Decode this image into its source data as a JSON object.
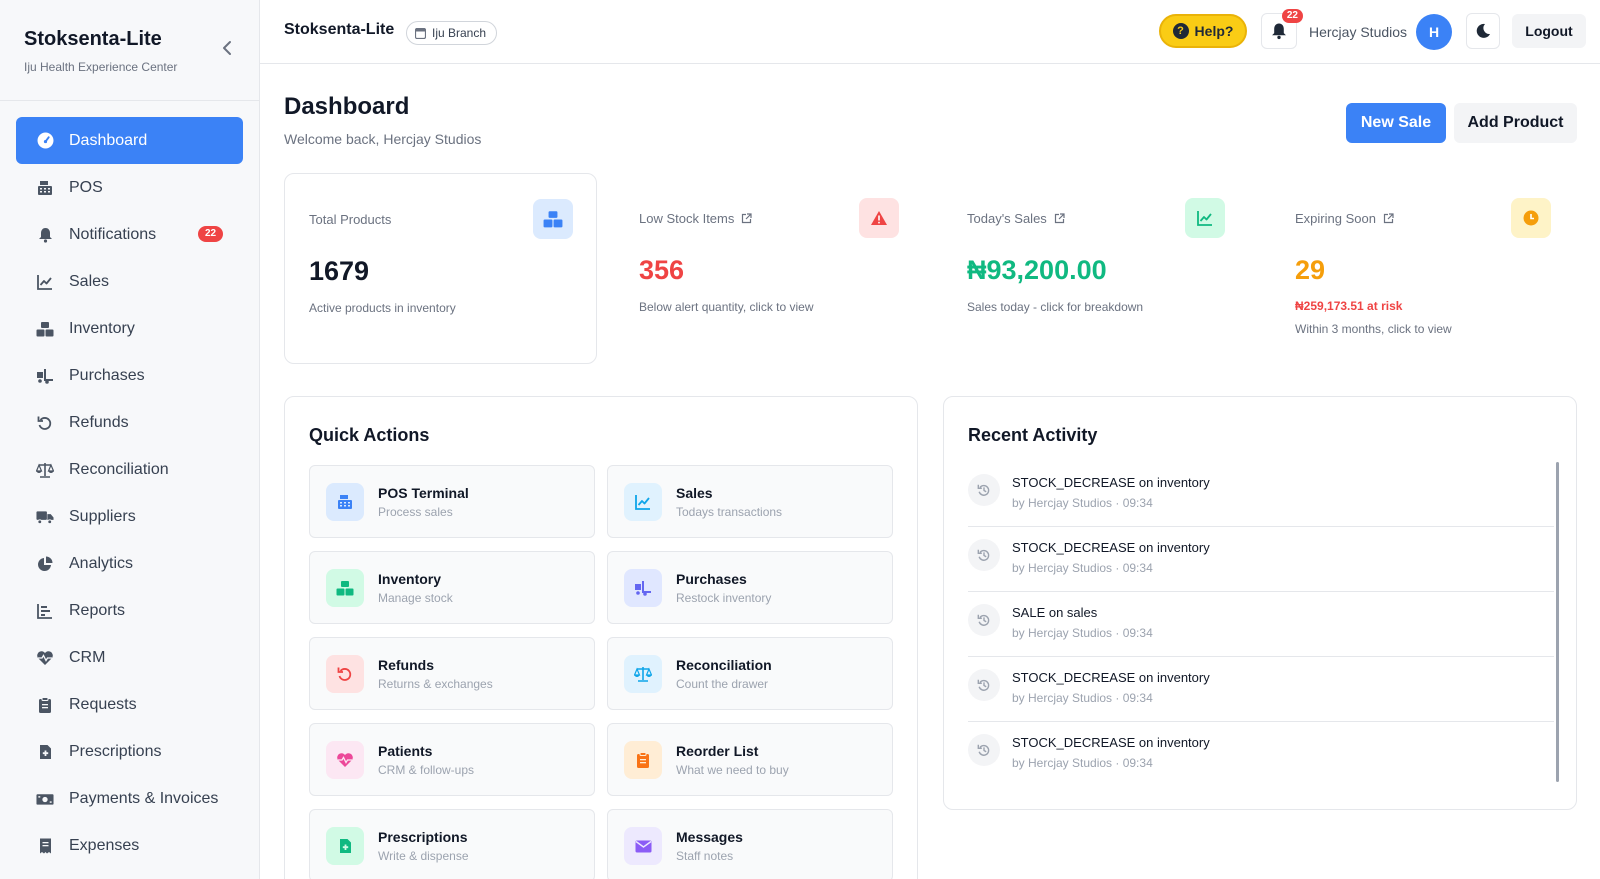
{
  "sidebar": {
    "brand_title": "Stoksenta-Lite",
    "brand_sub": "Iju Health Experience Center",
    "items": [
      {
        "label": "Dashboard",
        "icon": "gauge-icon",
        "active": true
      },
      {
        "label": "POS",
        "icon": "cash-register-icon"
      },
      {
        "label": "Notifications",
        "icon": "bell-icon",
        "badge": "22"
      },
      {
        "label": "Sales",
        "icon": "line-chart-icon"
      },
      {
        "label": "Inventory",
        "icon": "boxes-icon"
      },
      {
        "label": "Purchases",
        "icon": "truck-loading-icon"
      },
      {
        "label": "Refunds",
        "icon": "undo-icon"
      },
      {
        "label": "Reconciliation",
        "icon": "scale-icon"
      },
      {
        "label": "Suppliers",
        "icon": "truck-icon"
      },
      {
        "label": "Analytics",
        "icon": "pie-chart-icon"
      },
      {
        "label": "Reports",
        "icon": "bar-chart-icon"
      },
      {
        "label": "CRM",
        "icon": "heartbeat-icon"
      },
      {
        "label": "Requests",
        "icon": "clipboard-icon"
      },
      {
        "label": "Prescriptions",
        "icon": "file-medical-icon"
      },
      {
        "label": "Payments & Invoices",
        "icon": "money-icon"
      },
      {
        "label": "Expenses",
        "icon": "receipt-icon"
      }
    ]
  },
  "header": {
    "title": "Stoksenta-Lite",
    "branch": "Iju Branch",
    "help": "Help?",
    "notifications_count": "22",
    "user_name": "Hercjay Studios",
    "avatar_initial": "H",
    "logout": "Logout"
  },
  "main": {
    "title": "Dashboard",
    "subtitle": "Welcome back, Hercjay Studios",
    "new_sale": "New Sale",
    "add_product": "Add Product",
    "stats": [
      {
        "label": "Total Products",
        "value": "1679",
        "note": "Active products in inventory",
        "color": "#111827"
      },
      {
        "label": "Low Stock Items",
        "value": "356",
        "note": "Below alert quantity, click to view",
        "color": "#ef4444"
      },
      {
        "label": "Today's Sales",
        "value": "₦93,200.00",
        "note": "Sales today - click for breakdown",
        "color": "#10b981"
      },
      {
        "label": "Expiring Soon",
        "value": "29",
        "risk": "₦259,173.51 at risk",
        "note": "Within 3 months, click to view",
        "color": "#f59e0b"
      }
    ],
    "quick_actions_title": "Quick Actions",
    "quick_actions": [
      {
        "title": "POS Terminal",
        "sub": "Process sales"
      },
      {
        "title": "Sales",
        "sub": "Todays transactions"
      },
      {
        "title": "Inventory",
        "sub": "Manage stock"
      },
      {
        "title": "Purchases",
        "sub": "Restock inventory"
      },
      {
        "title": "Refunds",
        "sub": "Returns & exchanges"
      },
      {
        "title": "Reconciliation",
        "sub": "Count the drawer"
      },
      {
        "title": "Patients",
        "sub": "CRM & follow-ups"
      },
      {
        "title": "Reorder List",
        "sub": "What we need to buy"
      },
      {
        "title": "Prescriptions",
        "sub": "Write & dispense"
      },
      {
        "title": "Messages",
        "sub": "Staff notes"
      }
    ],
    "recent_activity_title": "Recent Activity",
    "activity": [
      {
        "title": "STOCK_DECREASE on inventory",
        "sub": "by Hercjay Studios · 09:34"
      },
      {
        "title": "STOCK_DECREASE on inventory",
        "sub": "by Hercjay Studios · 09:34"
      },
      {
        "title": "SALE on sales",
        "sub": "by Hercjay Studios · 09:34"
      },
      {
        "title": "STOCK_DECREASE on inventory",
        "sub": "by Hercjay Studios · 09:34"
      },
      {
        "title": "STOCK_DECREASE on inventory",
        "sub": "by Hercjay Studios · 09:34"
      }
    ]
  },
  "colors": {
    "accent": "#3b82f6",
    "danger": "#ef4444",
    "success": "#10b981",
    "warning": "#f59e0b",
    "help": "#facc15"
  }
}
